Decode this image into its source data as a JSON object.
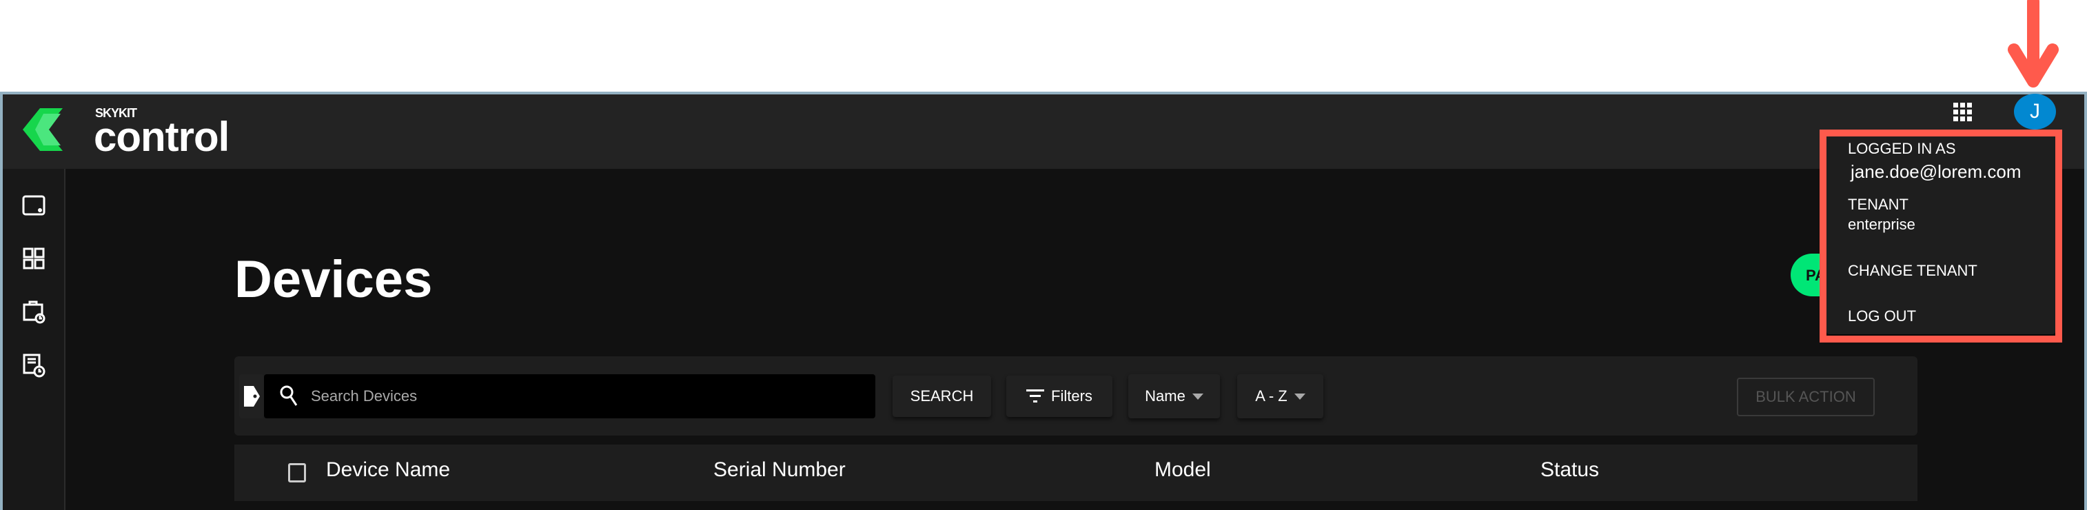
{
  "brand": {
    "small": "SKYKIT",
    "big": "control",
    "logo_colors": [
      "#16d64c",
      "#4be67e"
    ]
  },
  "header": {
    "apps_icon": "grid-icon",
    "avatar_initial": "J",
    "avatar_color": "#0288d1"
  },
  "sidebar": {
    "items": [
      {
        "icon": "device-icon"
      },
      {
        "icon": "dashboard-icon"
      },
      {
        "icon": "scheduled-work-icon"
      },
      {
        "icon": "history-report-icon"
      }
    ]
  },
  "page": {
    "title": "Devices",
    "pair_label": "PA"
  },
  "toolbar": {
    "search_placeholder": "Search Devices",
    "search_label": "SEARCH",
    "filters_label": "Filters",
    "sort_field": "Name",
    "sort_order": "A - Z",
    "bulk_label": "BULK ACTION"
  },
  "table": {
    "columns": [
      "Device Name",
      "Serial Number",
      "Model",
      "Status"
    ]
  },
  "user_menu": {
    "logged_in_label": "LOGGED IN AS",
    "email": "jane.doe@lorem.com",
    "tenant_label": "TENANT",
    "tenant": "enterprise",
    "change_tenant": "CHANGE TENANT",
    "logout": "LOG OUT"
  },
  "annotation": {
    "color": "#ff5a4c"
  }
}
